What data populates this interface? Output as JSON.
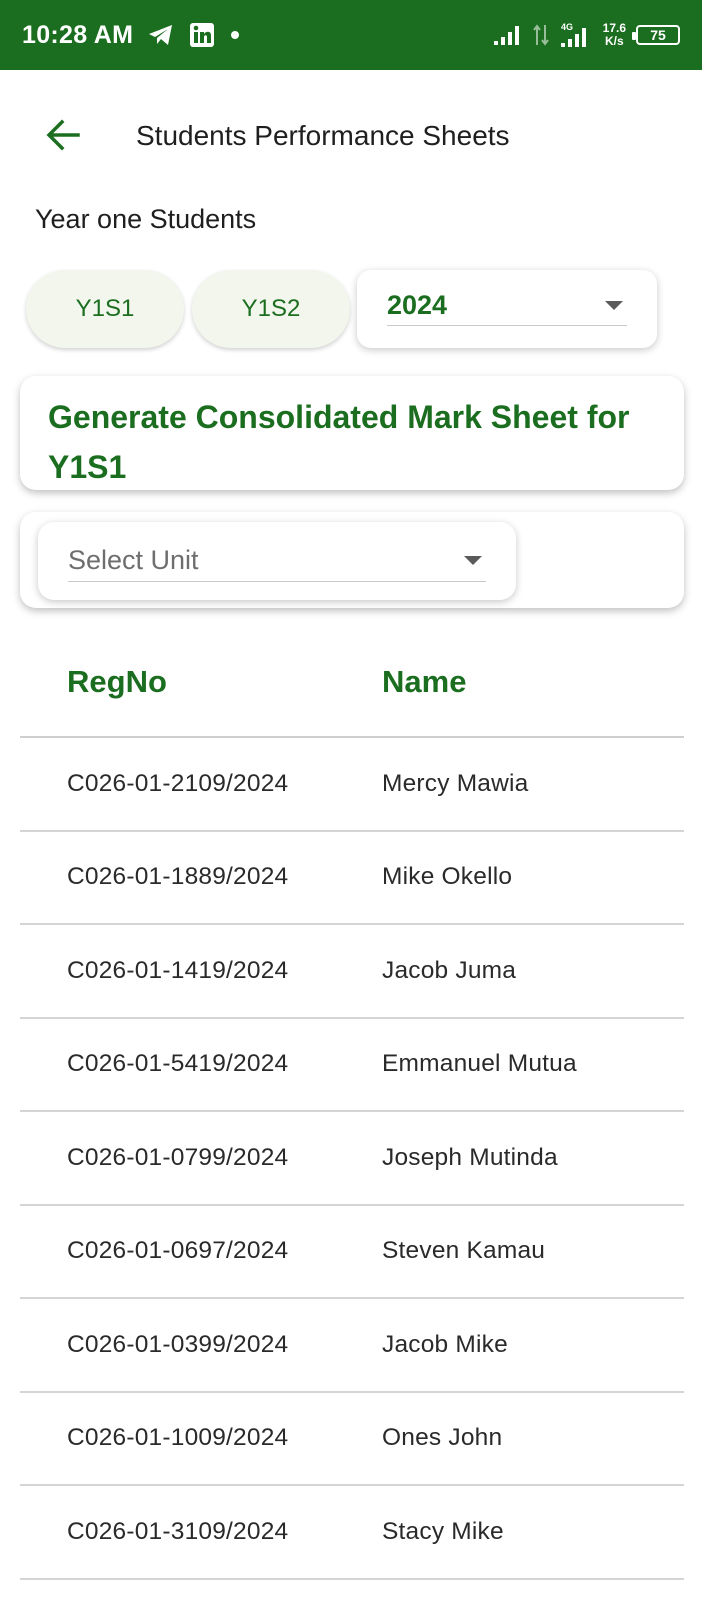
{
  "status_bar": {
    "time": "10:28 AM",
    "icons": [
      "telegram-icon",
      "linkedin-icon",
      "notification-dot-icon",
      "signal-icon",
      "data-arrows-icon",
      "signal-4g-icon"
    ],
    "network": "4G",
    "speed_value": "17.6",
    "speed_unit": "K/s",
    "battery": "75"
  },
  "app_bar": {
    "title": "Students Performance Sheets",
    "back_icon": "arrow-left-icon"
  },
  "section_title": "Year one Students",
  "semester_tabs": [
    {
      "label": "Y1S1"
    },
    {
      "label": "Y1S2"
    }
  ],
  "year_dropdown": {
    "value": "2024"
  },
  "generate_button": {
    "label": "Generate Consolidated Mark Sheet for Y1S1"
  },
  "unit_dropdown": {
    "placeholder": "Select Unit"
  },
  "table": {
    "headers": [
      "RegNo",
      "Name"
    ],
    "rows": [
      {
        "regno": "C026-01-2109/2024",
        "name": "Mercy Mawia"
      },
      {
        "regno": "C026-01-1889/2024",
        "name": "Mike Okello"
      },
      {
        "regno": "C026-01-1419/2024",
        "name": "Jacob Juma"
      },
      {
        "regno": "C026-01-5419/2024",
        "name": "Emmanuel Mutua"
      },
      {
        "regno": "C026-01-0799/2024",
        "name": "Joseph Mutinda"
      },
      {
        "regno": "C026-01-0697/2024",
        "name": "Steven Kamau"
      },
      {
        "regno": "C026-01-0399/2024",
        "name": "Jacob Mike"
      },
      {
        "regno": "C026-01-1009/2024",
        "name": "Ones John"
      },
      {
        "regno": "C026-01-3109/2024",
        "name": "Stacy Mike"
      }
    ]
  },
  "colors": {
    "status_bar": "#1b6e1f",
    "accent": "#1b6e1f",
    "chip_background": "#f2f6ec"
  }
}
